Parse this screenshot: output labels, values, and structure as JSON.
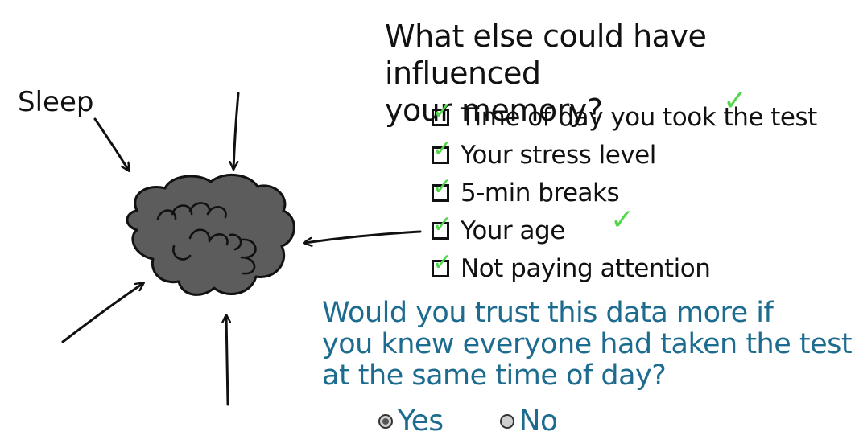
{
  "left_diagram": {
    "sleep_label": "Sleep"
  },
  "question1": {
    "line1": "What else could have influenced",
    "line2": "your memory?"
  },
  "checklist": [
    {
      "label": "Time of day you took the test",
      "checked": true
    },
    {
      "label": "Your stress level",
      "checked": true
    },
    {
      "label": "5-min breaks",
      "checked": true
    },
    {
      "label": "Your age",
      "checked": true
    },
    {
      "label": "Not paying attention",
      "checked": true
    }
  ],
  "question2": {
    "line1": "Would you trust this data more if",
    "line2": "you knew everyone had taken the test",
    "line3": "at the same time of day?"
  },
  "options": {
    "yes_label": "Yes",
    "no_label": "No",
    "selected": "Yes"
  },
  "colors": {
    "ink": "#111111",
    "brain_fill": "#5c5c5c",
    "check_green": "#52d64a",
    "question_blue": "#1d6c8f"
  },
  "icons": [
    "brain-icon",
    "arrow-icon",
    "checkbox-icon",
    "checkmark-icon",
    "radio-icon"
  ]
}
